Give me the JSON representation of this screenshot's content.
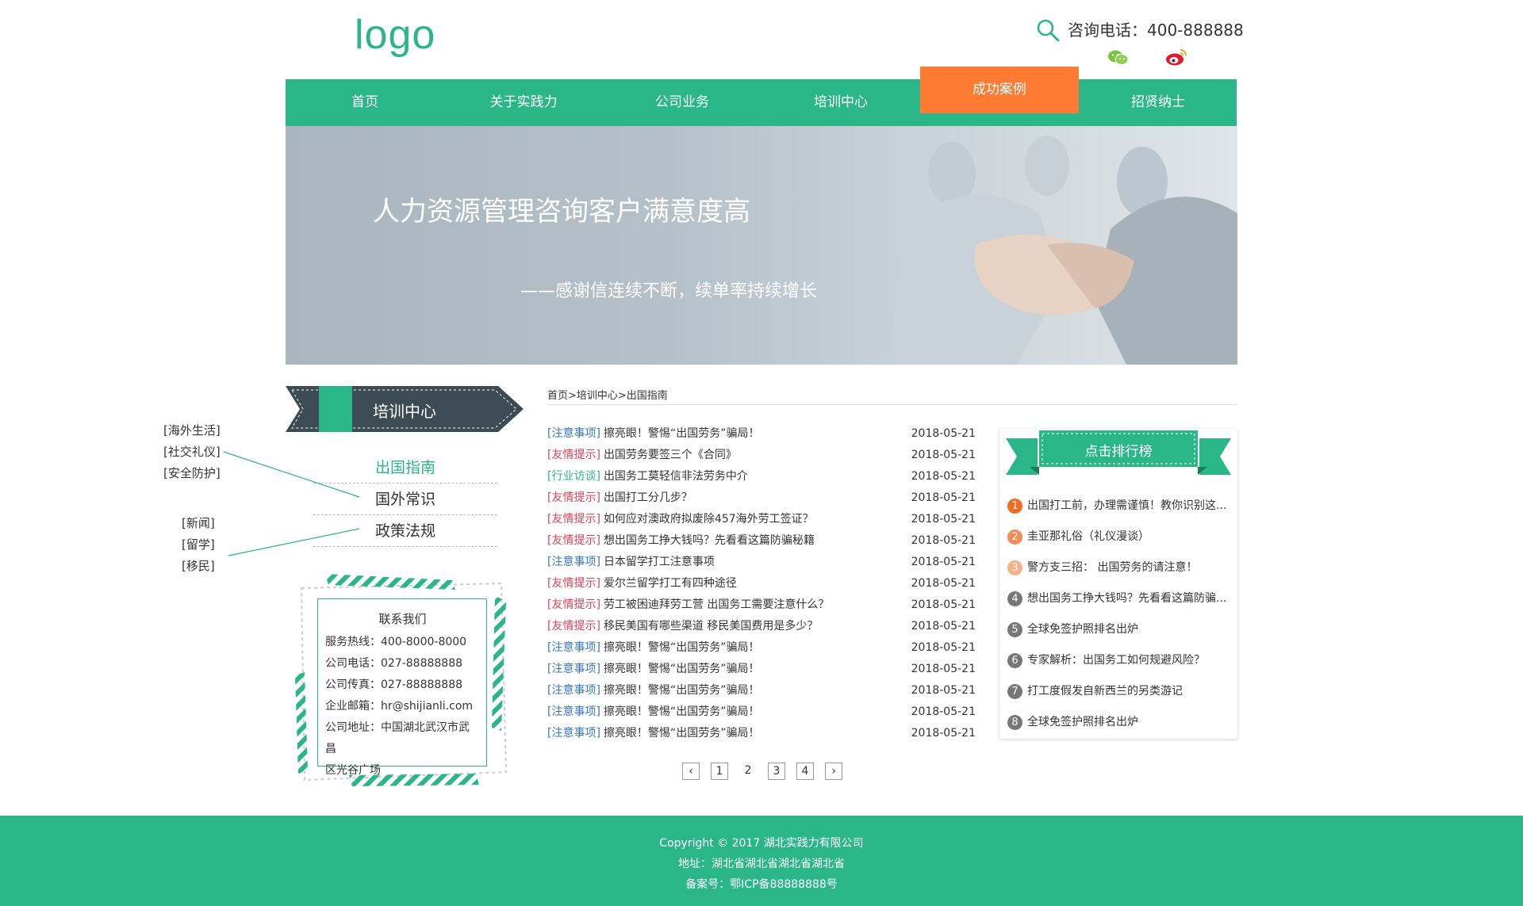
{
  "header": {
    "logo": "logo",
    "phone_label": "咨询电话：400-888888"
  },
  "nav": [
    {
      "label": "首页"
    },
    {
      "label": "关于实践力"
    },
    {
      "label": "公司业务"
    },
    {
      "label": "培训中心"
    },
    {
      "label": "成功案例"
    },
    {
      "label": "招贤纳士"
    }
  ],
  "banner": {
    "title": "人力资源管理咨询客户满意度高",
    "subtitle": "——感谢信连续不断，续单率持续增长"
  },
  "sidebar": {
    "heading": "培训中心",
    "menu": [
      {
        "label": "出国指南"
      },
      {
        "label": "国外常识"
      },
      {
        "label": "政策法规"
      }
    ],
    "tags_group1": [
      "[海外生活]",
      "[社交礼仪]",
      "[安全防护]"
    ],
    "tags_group2": [
      "[新闻]",
      "[留学]",
      "[移民]"
    ],
    "contact": {
      "title": "联系我们",
      "lines": [
        "服务热线：400-8000-8000",
        "公司电话：027-88888888",
        "公司传真：027-88888888",
        "企业邮箱：hr@shijianli.com",
        "公司地址：中国湖北武汉市武昌",
        "区光谷广场"
      ]
    }
  },
  "breadcrumb": "首页>培训中心>出国指南",
  "news": [
    {
      "cat": "[注意事项]",
      "color": "#3a78c2",
      "title": "擦亮眼！警惕“出国劳务”骗局！",
      "date": "2018-05-21"
    },
    {
      "cat": "[友情提示]",
      "color": "#e0425a",
      "title": "出国劳务要签三个《合同》",
      "date": "2018-05-21"
    },
    {
      "cat": "[行业访谈]",
      "color": "#2bb687",
      "title": "出国务工莫轻信非法劳务中介",
      "date": "2018-05-21"
    },
    {
      "cat": "[友情提示]",
      "color": "#e0425a",
      "title": "出国打工分几步？",
      "date": "2018-05-21"
    },
    {
      "cat": "[友情提示]",
      "color": "#e0425a",
      "title": "如何应对澳政府拟废除457海外劳工签证？",
      "date": "2018-05-21"
    },
    {
      "cat": "[友情提示]",
      "color": "#e0425a",
      "title": "想出国务工挣大钱吗？先看看这篇防骗秘籍",
      "date": "2018-05-21"
    },
    {
      "cat": "[注意事项]",
      "color": "#3a78c2",
      "title": "日本留学打工注意事项",
      "date": "2018-05-21"
    },
    {
      "cat": "[友情提示]",
      "color": "#e0425a",
      "title": "爱尔兰留学打工有四种途径",
      "date": "2018-05-21"
    },
    {
      "cat": "[友情提示]",
      "color": "#e0425a",
      "title": "劳工被困迪拜劳工营 出国务工需要注意什么？",
      "date": "2018-05-21"
    },
    {
      "cat": "[友情提示]",
      "color": "#e0425a",
      "title": "移民美国有哪些渠道 移民美国费用是多少？",
      "date": "2018-05-21"
    },
    {
      "cat": "[注意事项]",
      "color": "#3a78c2",
      "title": "擦亮眼！警惕“出国劳务”骗局！",
      "date": "2018-05-21"
    },
    {
      "cat": "[注意事项]",
      "color": "#3a78c2",
      "title": "擦亮眼！警惕“出国劳务”骗局！",
      "date": "2018-05-21"
    },
    {
      "cat": "[注意事项]",
      "color": "#3a78c2",
      "title": "擦亮眼！警惕“出国劳务”骗局！",
      "date": "2018-05-21"
    },
    {
      "cat": "[注意事项]",
      "color": "#3a78c2",
      "title": "擦亮眼！警惕“出国劳务”骗局！",
      "date": "2018-05-21"
    },
    {
      "cat": "[注意事项]",
      "color": "#3a78c2",
      "title": "擦亮眼！警惕“出国劳务”骗局！",
      "date": "2018-05-21"
    }
  ],
  "pager": {
    "pages": [
      "1",
      "2",
      "3",
      "4"
    ],
    "current": "2"
  },
  "ranking": {
    "title": "点击排行榜",
    "items": [
      {
        "num": "1",
        "color": "#f26b22",
        "title": "出国打工前，办理需谨慎！教你识别这..."
      },
      {
        "num": "2",
        "color": "#f58a55",
        "title": "圭亚那礼俗（礼仪漫谈）"
      },
      {
        "num": "3",
        "color": "#f7b08a",
        "title": "警方支三招： 出国劳务的请注意！"
      },
      {
        "num": "4",
        "color": "#777777",
        "title": "想出国务工挣大钱吗？先看看这篇防骗..."
      },
      {
        "num": "5",
        "color": "#777777",
        "title": "全球免签护照排名出炉"
      },
      {
        "num": "6",
        "color": "#777777",
        "title": "专家解析：出国务工如何规避风险？"
      },
      {
        "num": "7",
        "color": "#777777",
        "title": "打工度假发自新西兰的另类游记"
      },
      {
        "num": "8",
        "color": "#777777",
        "title": "全球免签护照排名出炉"
      }
    ]
  },
  "footer": {
    "copyright": "Copyright © 2017 湖北实践力有限公司",
    "address": "地址：湖北省湖北省湖北省湖北省",
    "icp": "备案号：鄂ICP备88888888号"
  },
  "colors": {
    "brand": "#2bb687",
    "accent": "#ff7a33",
    "dark": "#3d4b55"
  }
}
